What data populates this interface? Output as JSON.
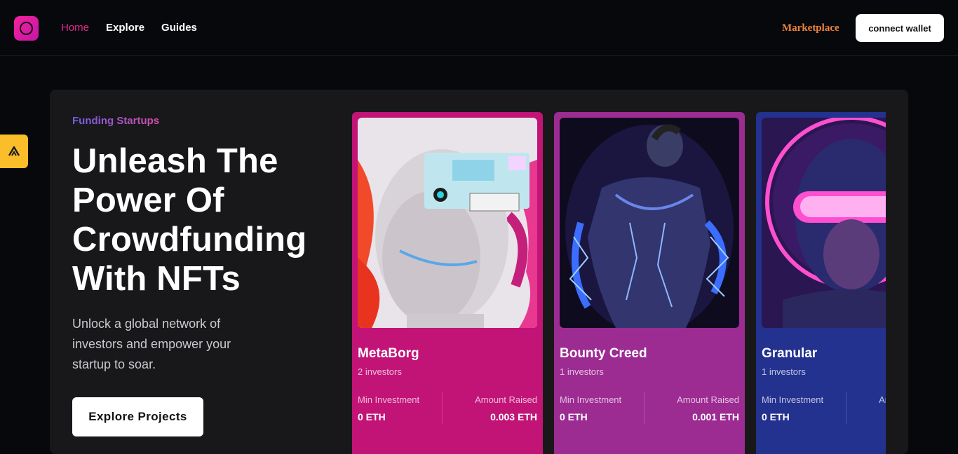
{
  "nav": {
    "links": [
      {
        "label": "Home",
        "active": true
      },
      {
        "label": "Explore",
        "active": false
      },
      {
        "label": "Guides",
        "active": false
      }
    ],
    "marketplace_label": "Marketplace",
    "connect_label": "connect wallet"
  },
  "hero": {
    "eyebrow": "Funding Startups",
    "headline": "Unleash The Power Of Crowdfunding With NFTs",
    "subtitle": "Unlock a global network of investors and empower your startup to soar.",
    "cta_label": "Explore Projects"
  },
  "cards": [
    {
      "name": "MetaBorg",
      "investors": "2 investors",
      "min_label": "Min Investment",
      "min_value": "0 ETH",
      "raised_label": "Amount Raised",
      "raised_value": "0.003 ETH",
      "color": "#c21477"
    },
    {
      "name": "Bounty Creed",
      "investors": "1 investors",
      "min_label": "Min Investment",
      "min_value": "0 ETH",
      "raised_label": "Amount Raised",
      "raised_value": "0.001 ETH",
      "color": "#9c2b92"
    },
    {
      "name": "Granular",
      "investors": "1 investors",
      "min_label": "Min Investment",
      "min_value": "0 ETH",
      "raised_label": "Amount Raised",
      "raised_value": "",
      "color": "#23318f"
    }
  ],
  "icons": {
    "logo": "brand-ring-icon",
    "side_badge": "chevron-up-icon"
  }
}
